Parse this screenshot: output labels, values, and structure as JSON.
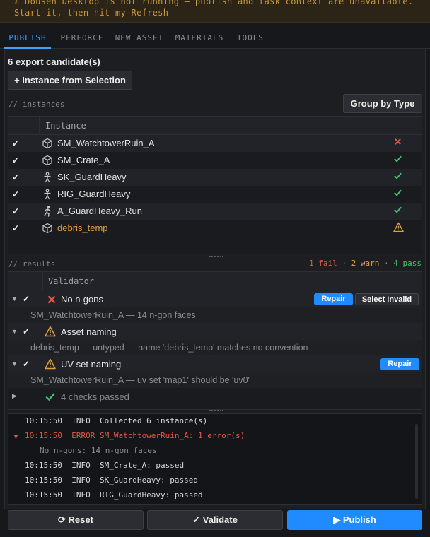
{
  "banner": {
    "text": "⚠ Dousen Desktop is not running — publish and task context are unavailable. Start it, then hit my Refresh"
  },
  "tabs": [
    "PUBLISH",
    "PERFORCE",
    "NEW ASSET",
    "MATERIALS",
    "TOOLS"
  ],
  "active_tab": "PUBLISH",
  "export_count_label": "6 export candidate(s)",
  "instance_button": "+ Instance from Selection",
  "instances_section_label": "// instances",
  "group_button": "Group by Type",
  "instances_header": "Instance",
  "instances": [
    {
      "checked": "✓",
      "icon": "cube-icon",
      "name": "SM_WatchtowerRuin_A",
      "status": "fail"
    },
    {
      "checked": "✓",
      "icon": "cube-icon",
      "name": "SM_Crate_A",
      "status": "pass"
    },
    {
      "checked": "✓",
      "icon": "skeleton-icon",
      "name": "SK_GuardHeavy",
      "status": "pass"
    },
    {
      "checked": "✓",
      "icon": "skeleton-icon",
      "name": "RIG_GuardHeavy",
      "status": "pass"
    },
    {
      "checked": "✓",
      "icon": "running-icon",
      "name": "A_GuardHeavy_Run",
      "status": "pass"
    },
    {
      "checked": "✓",
      "icon": "cube-icon",
      "name": "debris_temp",
      "status": "warn"
    }
  ],
  "results_section_label": "// results",
  "summary": {
    "fail": "1 fail",
    "warn": "2 warn",
    "pass": "4 pass",
    "sep": "·"
  },
  "validator_header": "Validator",
  "validators": [
    {
      "name": "No n-gons",
      "status": "fail",
      "detail": "SM_WatchtowerRuin_A — 14 n-gon faces",
      "repair": "Repair",
      "select": "Select Invalid"
    },
    {
      "name": "Asset naming",
      "status": "warn",
      "detail": "debris_temp — untyped — name 'debris_temp' matches no convention"
    },
    {
      "name": "UV set naming",
      "status": "warn",
      "detail": "SM_WatchtowerRuin_A — uv set 'map1' should be 'uv0'",
      "repair": "Repair"
    }
  ],
  "passed_summary": "4 checks passed",
  "log": [
    {
      "text": "10:15:50  INFO  Collected 6 instance(s)",
      "level": "info"
    },
    {
      "text": "10:15:50  ERROR SM_WatchtowerRuin_A: 1 error(s)",
      "level": "error"
    },
    {
      "text": "No n-gons: 14 n-gon faces",
      "level": "detail"
    },
    {
      "text": "10:15:50  INFO  SM_Crate_A: passed",
      "level": "info"
    },
    {
      "text": "10:15:50  INFO  SK_GuardHeavy: passed",
      "level": "info"
    },
    {
      "text": "10:15:50  INFO  RIG_GuardHeavy: passed",
      "level": "info"
    }
  ],
  "footer": {
    "reset": "⟳ Reset",
    "validate": "✓ Validate",
    "publish": "▶ Publish"
  },
  "colors": {
    "accent": "#1f8bff",
    "fail": "#e0584c",
    "warn": "#e0a040",
    "pass": "#3ec46d"
  }
}
